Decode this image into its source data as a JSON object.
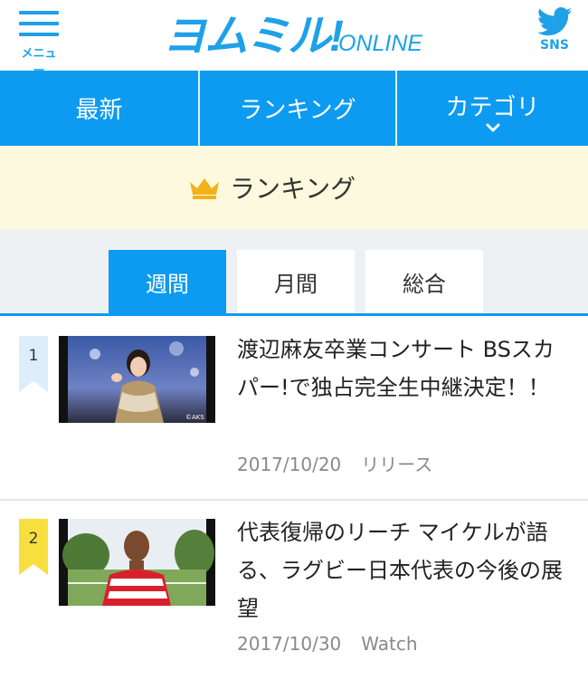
{
  "header": {
    "menu_label": "メニュー",
    "logo_text": "ヨムミル!",
    "logo_suffix": "ONLINE",
    "sns_label": "SNS"
  },
  "nav": {
    "items": [
      {
        "label": "最新"
      },
      {
        "label": "ランキング"
      },
      {
        "label": "カテゴリ"
      }
    ]
  },
  "ranking": {
    "title": "ランキング"
  },
  "tabs": [
    {
      "label": "週間",
      "active": true
    },
    {
      "label": "月間",
      "active": false
    },
    {
      "label": "総合",
      "active": false
    }
  ],
  "articles": [
    {
      "rank": "1",
      "title": "渡辺麻友卒業コンサート BSスカパー!で独占完全生中継決定！！",
      "date": "2017/10/20",
      "category": "リリース",
      "thumb_watermark": "©AKS"
    },
    {
      "rank": "2",
      "title": "代表復帰のリーチ マイケルが語る、ラグビー日本代表の今後の展望",
      "date": "2017/10/30",
      "category": "Watch"
    }
  ],
  "colors": {
    "accent": "#0c9bf0",
    "logo": "#1ea1e8",
    "banner_bg": "#fdf9de",
    "crown": "#f2b21c",
    "rank1_flag": "#dceefa",
    "rank2_flag": "#f7df3e"
  },
  "icons": {
    "menu": "hamburger-icon",
    "sns": "twitter-bird-icon",
    "nav_chevron": "chevron-down-icon",
    "ranking": "crown-icon"
  }
}
